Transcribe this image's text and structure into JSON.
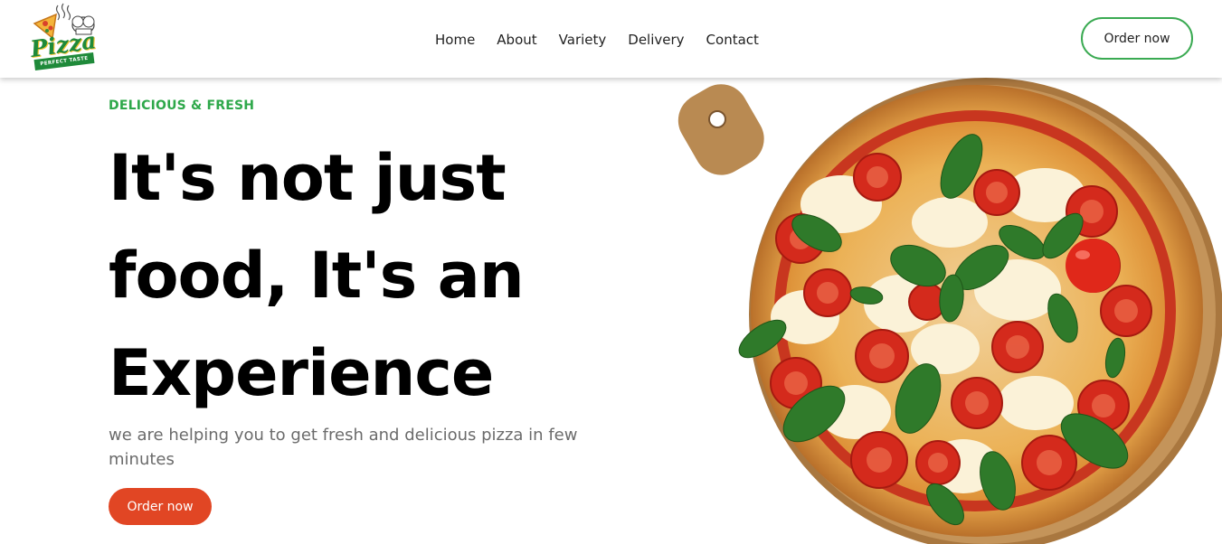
{
  "brand": {
    "logo_text": "Pizza",
    "logo_tagline": "PERFECT TASTE"
  },
  "nav": {
    "links": [
      "Home",
      "About",
      "Variety",
      "Delivery",
      "Contact"
    ],
    "order_button": "Order now"
  },
  "hero": {
    "eyebrow": "DELICIOUS & FRESH",
    "headline_lines": [
      "It's not just",
      "food, It's an",
      "Experience"
    ],
    "subtext": "we are helping you to get fresh and delicious pizza in few minutes",
    "order_button": "Order now"
  },
  "colors": {
    "accent_green": "#2ea84a",
    "button_orange": "#e14624",
    "text_dark": "#000000",
    "text_muted": "#6b6b6b"
  },
  "icons": [
    "pizza-logo-icon",
    "pizza-image"
  ]
}
